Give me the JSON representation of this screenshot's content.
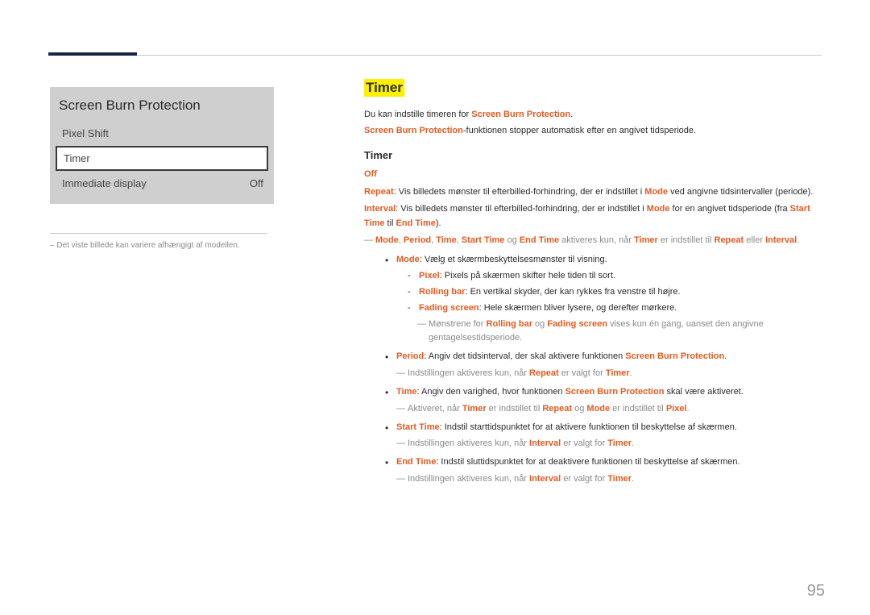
{
  "page_number": "95",
  "menu": {
    "title": "Screen Burn Protection",
    "item_pixel_shift": "Pixel Shift",
    "item_timer": "Timer",
    "item_immediate_display": "Immediate display",
    "item_immediate_display_value": "Off"
  },
  "left_footnote": "Det viste billede kan variere afhængigt af modellen.",
  "section": {
    "heading": "Timer",
    "intro_prefix": "Du kan indstille timeren for ",
    "intro_term": "Screen Burn Protection",
    "intro_suffix": ".",
    "line2_term": "Screen Burn Protection",
    "line2_suffix": "-funktionen stopper automatisk efter en angivet tidsperiode.",
    "subheading": "Timer",
    "off": "Off",
    "repeat_label": "Repeat",
    "repeat_text_1": ": Vis billedets mønster til efterbilled-forhindring, der er indstillet i ",
    "mode_word": "Mode",
    "repeat_text_2": " ved angivne tidsintervaller (periode).",
    "interval_label": "Interval",
    "interval_text_1": ": Vis billedets mønster til efterbilled-forhindring, der er indstillet i ",
    "interval_text_2": " for en angivet tidsperiode (fra ",
    "start_time": "Start Time",
    "til": " til ",
    "end_time": "End Time",
    "interval_text_3": ").",
    "note1_words": {
      "mode": "Mode",
      "period": "Period",
      "time": "Time",
      "starttime": "Start Time",
      "og": " og ",
      "endtime": "End Time",
      "mid": " aktiveres kun, når ",
      "timer": "Timer",
      "mid2": " er indstillet til ",
      "repeat": "Repeat",
      "eller": " eller ",
      "interval": "Interval",
      "end": "."
    },
    "b_mode_label": "Mode",
    "b_mode_text": ": Vælg et skærmbeskyttelsesmønster til visning.",
    "pixel_label": "Pixel",
    "pixel_text": ": Pixels på skærmen skifter hele tiden til sort.",
    "rolling_label": "Rolling bar",
    "rolling_text": ": En vertikal skyder, der kan rykkes fra venstre til højre.",
    "fading_label": "Fading screen",
    "fading_text": ": Hele skærmen bliver lysere, og derefter mørkere.",
    "note2_pre": "Mønstrene for ",
    "note2_rb": "Rolling bar",
    "note2_og": " og ",
    "note2_fs": "Fading screen",
    "note2_post": " vises kun én gang, uanset den angivne gentagelsestidsperiode.",
    "b_period_label": "Period",
    "b_period_text_1": ": Angiv det tidsinterval, der skal aktivere funktionen ",
    "b_period_term": "Screen Burn Protection",
    "b_period_text_2": ".",
    "note3_pre": "Indstillingen aktiveres kun, når ",
    "note3_repeat": "Repeat",
    "note3_mid": " er valgt for ",
    "note3_timer": "Timer",
    "note3_end": ".",
    "b_time_label": "Time",
    "b_time_text_1": ": Angiv den varighed, hvor funktionen ",
    "b_time_term": "Screen Burn Protection",
    "b_time_text_2": " skal være aktiveret.",
    "note4_pre": "Aktiveret, når ",
    "note4_timer": "Timer",
    "note4_mid1": " er indstillet til ",
    "note4_repeat": "Repeat",
    "note4_og": " og ",
    "note4_mode": "Mode",
    "note4_mid2": " er indstillet til ",
    "note4_pixel": "Pixel",
    "note4_end": ".",
    "b_start_label": "Start Time",
    "b_start_text": ": Indstil starttidspunktet for at aktivere funktionen til beskyttelse af skærmen.",
    "note5_pre": "Indstillingen aktiveres kun, når ",
    "note5_interval": "Interval",
    "note5_mid": " er valgt for ",
    "note5_timer": "Timer",
    "note5_end": ".",
    "b_end_label": "End Time",
    "b_end_text": ": Indstil sluttidspunktet for at deaktivere funktionen til beskyttelse af skærmen.",
    "note6_pre": "Indstillingen aktiveres kun, når ",
    "note6_interval": "Interval",
    "note6_mid": " er valgt for ",
    "note6_timer": "Timer",
    "note6_end": "."
  }
}
